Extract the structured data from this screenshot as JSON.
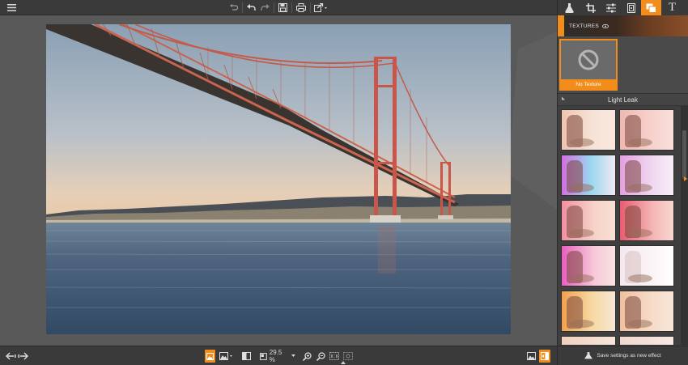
{
  "toolbar": {
    "menu_icon": "hamburger-icon",
    "buttons": [
      "undo-all-icon",
      "undo-icon",
      "redo-icon",
      "save-icon",
      "print-icon",
      "share-icon"
    ]
  },
  "panel": {
    "tabs": [
      "flask-icon",
      "crop-icon",
      "sliders-icon",
      "frame-icon",
      "layers-icon",
      "text-icon"
    ],
    "active_tab_index": 4,
    "texture_header": "TEXTURES",
    "no_texture_label": "No Texture",
    "section_title": "Light Leak",
    "save_effect_label": "Save settings as new effect"
  },
  "bottombar": {
    "zoom_value": "29.5 %"
  },
  "colors": {
    "accent": "#f28c1a",
    "background": "#595959",
    "panel": "#3c3c3c"
  }
}
